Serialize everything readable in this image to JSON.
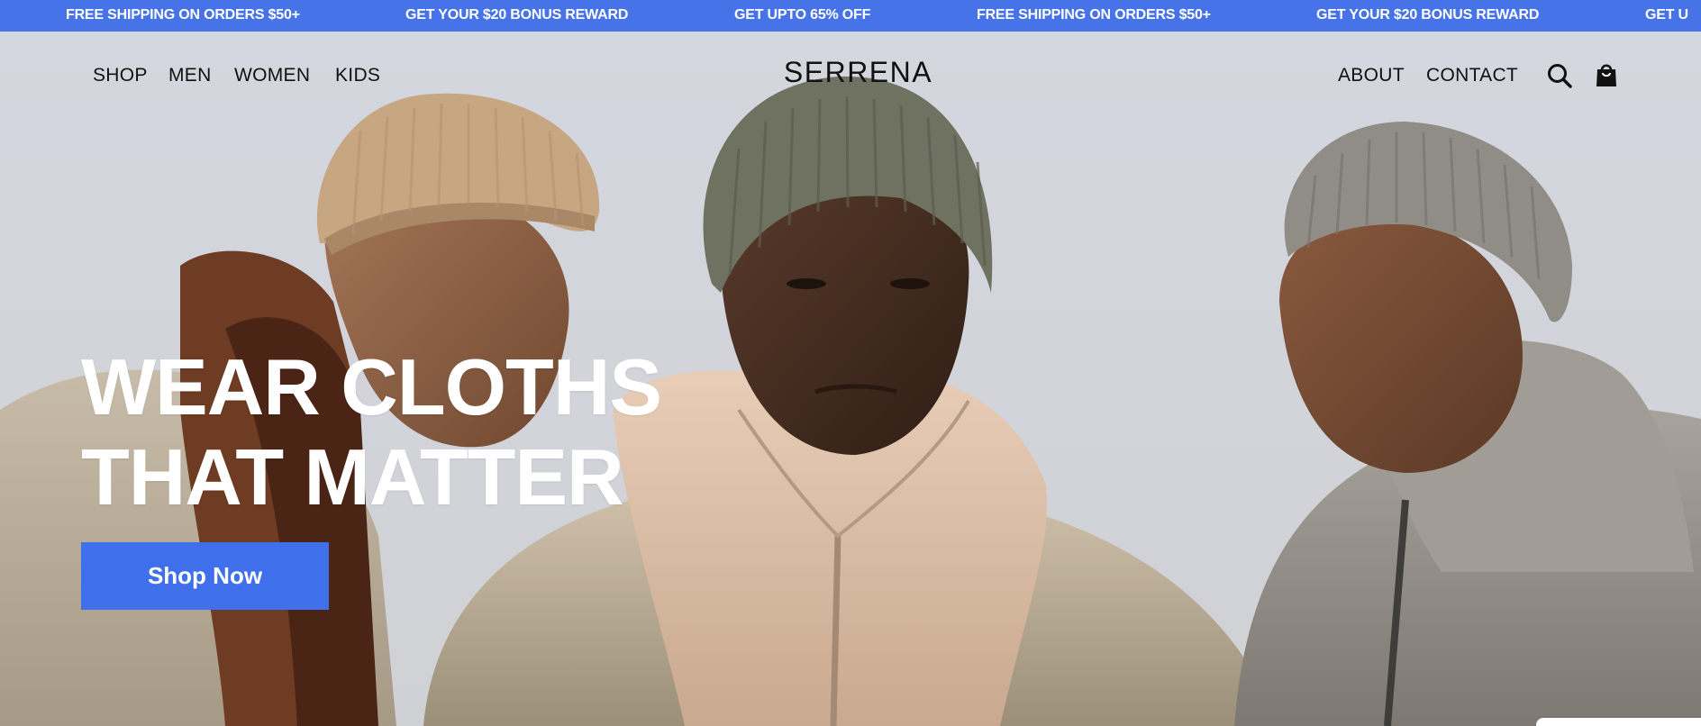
{
  "announcement_bar": {
    "color": "#4673e8",
    "messages": [
      "FREE SHIPPING ON ORDERS $50+",
      "GET YOUR $20 BONUS REWARD",
      "GET UPTO 65% OFF",
      "FREE SHIPPING ON ORDERS $50+",
      "GET YOUR $20 BONUS REWARD",
      "GET U"
    ]
  },
  "header": {
    "nav_left": [
      "SHOP",
      "MEN",
      "WOMEN",
      "KIDS"
    ],
    "brand": "SERRENA",
    "nav_right": [
      "ABOUT",
      "CONTACT"
    ],
    "icons": [
      "search-icon",
      "shopping-bag-icon"
    ]
  },
  "hero": {
    "headline_line1": "WEAR CLOTHS",
    "headline_line2": "THAT MATTER",
    "cta_label": "Shop Now",
    "cta_color": "#3f6fea"
  }
}
